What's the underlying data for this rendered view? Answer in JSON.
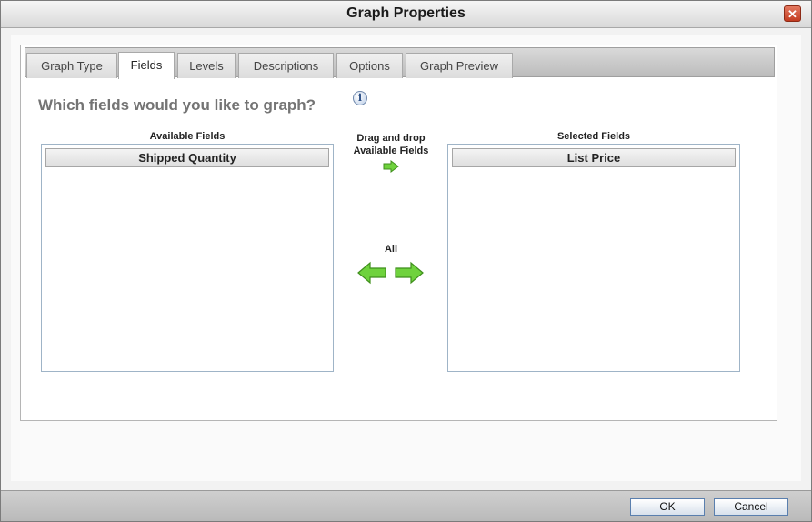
{
  "dialog": {
    "title": "Graph Properties",
    "close_glyph": "✕"
  },
  "tabs": [
    {
      "label": "Graph Type"
    },
    {
      "label": "Fields",
      "active": true
    },
    {
      "label": "Levels"
    },
    {
      "label": "Descriptions"
    },
    {
      "label": "Options"
    },
    {
      "label": "Graph Preview"
    }
  ],
  "content": {
    "heading": "Which fields would you like to graph?",
    "info_glyph": "i",
    "available": {
      "label": "Available Fields",
      "items": [
        "Shipped Quantity"
      ]
    },
    "selected": {
      "label": "Selected Fields",
      "items": [
        "List Price"
      ]
    },
    "drag_hint_line1": "Drag and drop",
    "drag_hint_line2": "Available Fields",
    "all_label": "All"
  },
  "footer": {
    "ok_label": "OK",
    "cancel_label": "Cancel"
  },
  "colors": {
    "accent_green": "#5cbf2a",
    "close_red": "#c23b20"
  },
  "icons": [
    "info-icon",
    "arrow-right-icon",
    "arrow-left-icon",
    "close-icon"
  ]
}
